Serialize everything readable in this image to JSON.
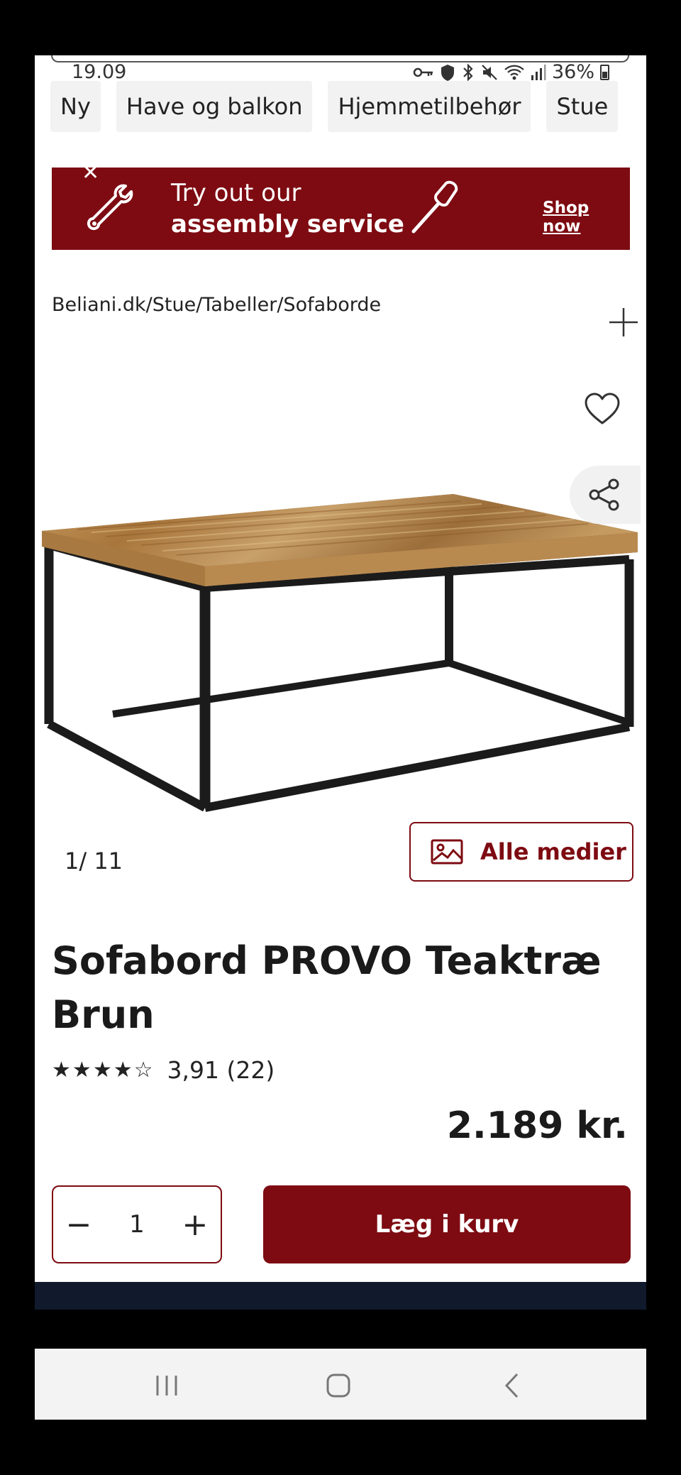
{
  "status": {
    "time": "19.09",
    "battery": "36%",
    "icons": [
      "key-icon",
      "vpn-icon",
      "bluetooth-icon",
      "mute-icon",
      "wifi-icon",
      "signal-icon",
      "battery-icon"
    ]
  },
  "nav": {
    "categories": [
      "Ny",
      "Have og balkon",
      "Hjemmetilbehør",
      "Stue"
    ]
  },
  "promo": {
    "line1": "Try out our",
    "line2": "assembly service",
    "cta": "Shop now",
    "background": "#7e0b12"
  },
  "breadcrumb": "Beliani.dk/Stue/Tabeller/Sofaborde",
  "gallery": {
    "counter": "1/ 11",
    "all_media_label": "Alle medier"
  },
  "product": {
    "title": "Sofabord PROVO Teaktræ Brun",
    "rating_text": "3,91 (22)",
    "rating": 3.91,
    "rating_max": 5,
    "price": "2.189 kr.",
    "quantity": "1",
    "add_to_cart_label": "Læg i kurv"
  },
  "colors": {
    "brand": "#7e0b12",
    "footer": "#101a2c"
  }
}
